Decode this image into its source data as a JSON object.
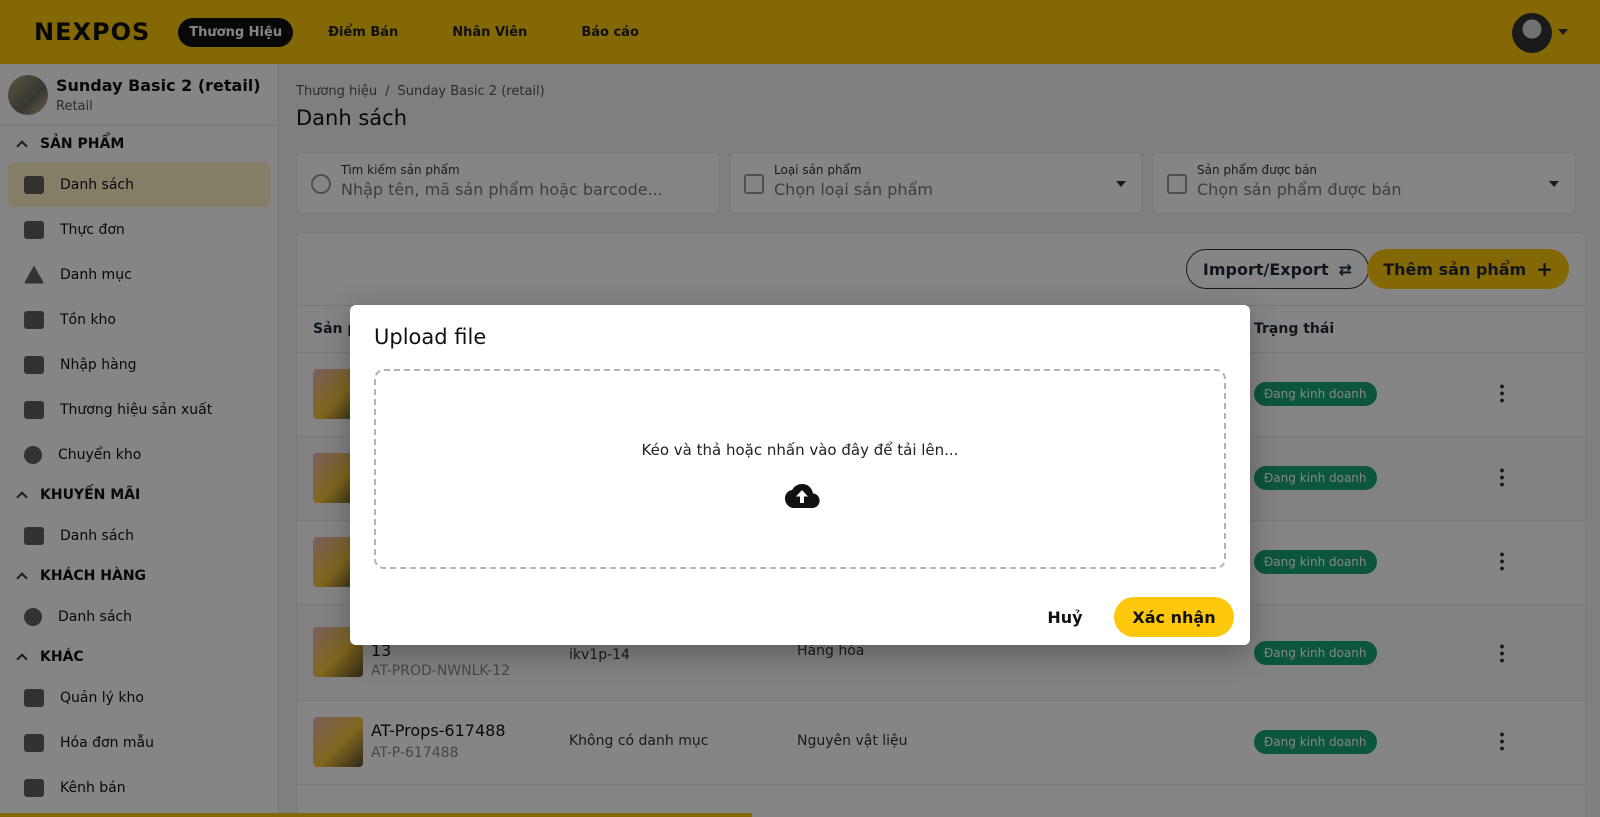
{
  "topbar": {
    "logo": "NEXPOS",
    "nav": [
      "Thương Hiệu",
      "Điểm Bán",
      "Nhân Viên",
      "Báo cáo"
    ]
  },
  "sidebar": {
    "brand_name": "Sunday Basic 2 (retail)",
    "brand_type": "Retail",
    "sections": [
      {
        "title": "SẢN PHẨM",
        "items": [
          "Danh sách",
          "Thực đơn",
          "Danh mục",
          "Tồn kho",
          "Nhập hàng",
          "Thương hiệu sản xuất",
          "Chuyển kho"
        ]
      },
      {
        "title": "KHUYẾN MÃI",
        "items": [
          "Danh sách"
        ]
      },
      {
        "title": "KHÁCH HÀNG",
        "items": [
          "Danh sách"
        ]
      },
      {
        "title": "KHÁC",
        "items": [
          "Quản lý kho",
          "Hóa đơn mẫu",
          "Kênh bán"
        ]
      }
    ]
  },
  "main": {
    "breadcrumb": [
      "Thương hiệu",
      "Sunday Basic 2 (retail)"
    ],
    "title": "Danh sách",
    "filters": [
      {
        "label": "Tìm kiếm sản phẩm",
        "placeholder": "Nhập tên, mã sản phẩm hoặc barcode..."
      },
      {
        "label": "Loại sản phẩm",
        "value": "Chọn loại sản phẩm"
      },
      {
        "label": "Sản phẩm được bán",
        "value": "Chọn sản phẩm được bán"
      }
    ],
    "import_export": "Import/Export",
    "add_product": "Thêm sản phẩm",
    "columns": [
      "Sản p",
      "Trạng thái"
    ],
    "rows": [
      {
        "name": "",
        "sku": "",
        "category": "",
        "type": "",
        "status": "Đang kinh doanh"
      },
      {
        "name": "",
        "sku": "",
        "category": "",
        "type": "",
        "status": "Đang kinh doanh"
      },
      {
        "name": "",
        "sku": "",
        "category": "",
        "type": "",
        "status": "Đang kinh doanh"
      },
      {
        "name": "13",
        "sku": "AT-PROD-NWNLK-12",
        "category": "ikv1p-14",
        "type": "Hàng hóa",
        "status": "Đang kinh doanh"
      },
      {
        "name": "AT-Props-617488",
        "sku": "AT-P-617488",
        "category": "Không có danh mục",
        "type": "Nguyên vật liệu",
        "status": "Đang kinh doanh"
      }
    ]
  },
  "modal": {
    "title": "Upload file",
    "dropzone_text": "Kéo và thả hoặc nhấn vào đây để tải lên...",
    "cancel": "Huỷ",
    "confirm": "Xác nhận"
  }
}
